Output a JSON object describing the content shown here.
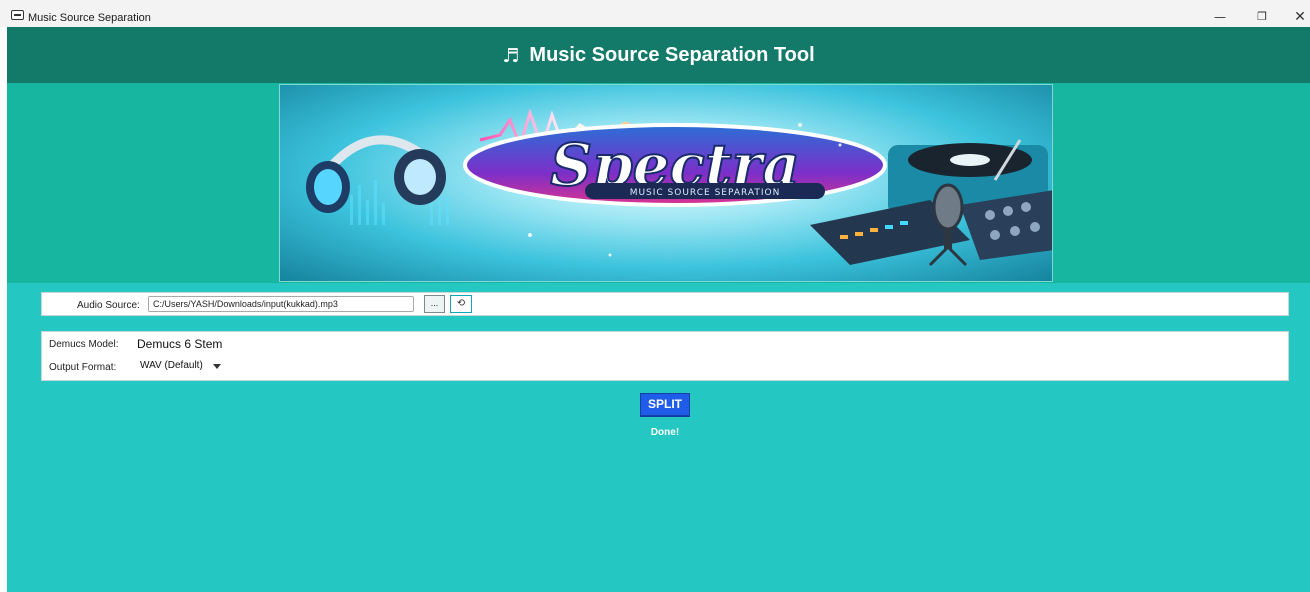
{
  "window": {
    "title": "Music Source Separation",
    "icons": {
      "app": "window-app-icon",
      "minimize": "minimize-icon",
      "maximize": "restore-icon",
      "close": "close-icon"
    }
  },
  "header": {
    "icon": "music-note-icon",
    "icon_glyph": "♬",
    "title": "Music Source Separation Tool"
  },
  "banner": {
    "logo_text": "Spectra",
    "logo_subtitle": "MUSIC SOURCE SEPARATION"
  },
  "source": {
    "label": "Audio Source:",
    "path": "C:/Users/YASH/Downloads/input(kukkad).mp3",
    "browse_label": "...",
    "reset_icon": "refresh-icon",
    "reset_glyph": "⟲"
  },
  "model": {
    "label": "Demucs Model:",
    "value": "Demucs 6 Stem",
    "format_label": "Output Format:",
    "format_value": "WAV (Default)"
  },
  "actions": {
    "split_label": "SPLIT",
    "status": "Done!"
  },
  "colors": {
    "header": "#137a6a",
    "banner_band": "#16b6a0",
    "background": "#25c7c3",
    "split_button": "#1f5de8"
  }
}
